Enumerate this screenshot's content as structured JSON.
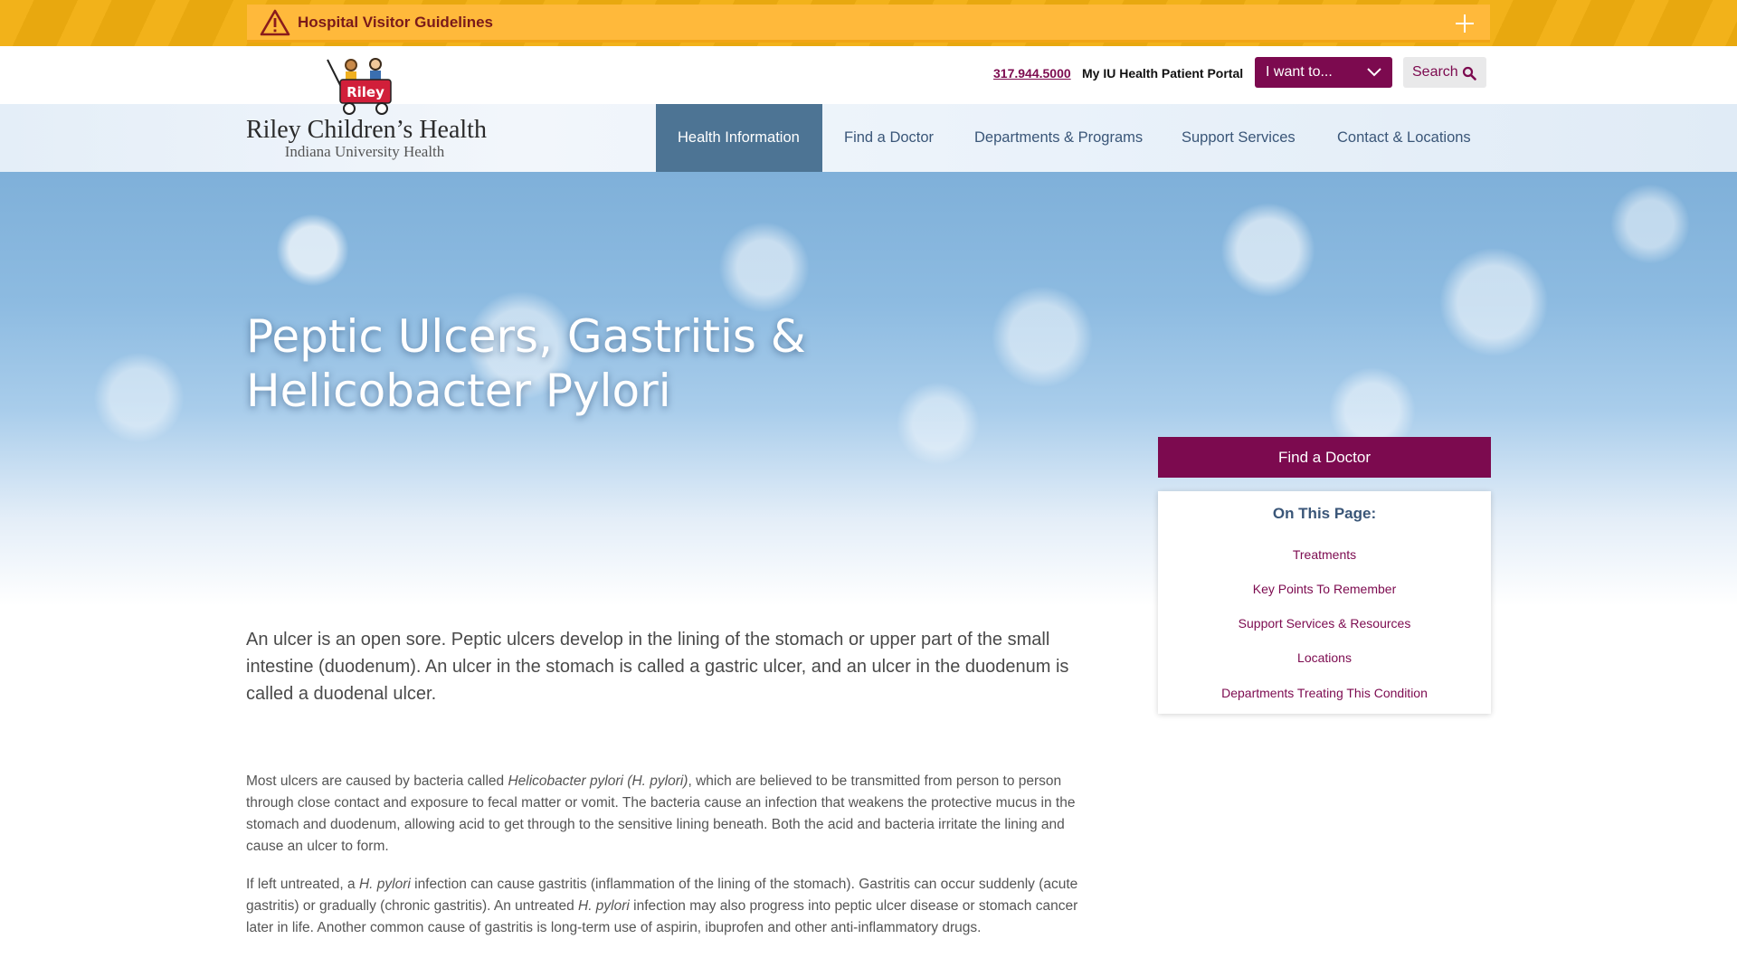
{
  "alert": {
    "title": "Hospital Visitor Guidelines",
    "icon": "warning-triangle-icon",
    "toggle_icon": "plus-icon"
  },
  "utility": {
    "phone": "317.944.5000",
    "portal": "My IU Health Patient Portal",
    "i_want": "I want to...",
    "search": "Search"
  },
  "logo": {
    "badge_text": "Riley",
    "title": "Riley Children’s Health",
    "subtitle": "Indiana University Health"
  },
  "nav": {
    "items": [
      {
        "label": "Health Information",
        "active": true
      },
      {
        "label": "Find a Doctor",
        "active": false
      },
      {
        "label": "Departments & Programs",
        "active": false
      },
      {
        "label": "Support Services",
        "active": false
      },
      {
        "label": "Contact & Locations",
        "active": false
      }
    ]
  },
  "hero": {
    "title": "Peptic Ulcers, Gastritis & Helicobacter Pylori"
  },
  "sidebar": {
    "find_doctor": "Find a Doctor",
    "on_this_page": "On This Page:",
    "links": [
      "Treatments",
      "Key Points To Remember",
      "Support Services & Resources",
      "Locations",
      "Departments Treating This Condition"
    ]
  },
  "content": {
    "intro": "An ulcer is an open sore. Peptic ulcers develop in the lining of the stomach or upper part of the small intestine (duodenum). An ulcer in the stomach is called a gastric ulcer, and an ulcer in the duodenum is called a duodenal ulcer.",
    "p1_a": "Most ulcers are caused by bacteria called ",
    "p1_em": "Helicobacter pylori (H. pylori)",
    "p1_b": ", which are believed to be transmitted from person to person through close contact and exposure to fecal matter or vomit. The bacteria cause an infection that weakens the protective mucus in the stomach and duodenum, allowing acid to get through to the sensitive lining beneath. Both the acid and bacteria irritate the lining and cause an ulcer to form.",
    "p2_a": "If left untreated, a ",
    "p2_em1": "H. pylori",
    "p2_b": " infection can cause gastritis (inflammation of the lining of the stomach). Gastritis can occur suddenly (acute gastritis) or gradually (chronic gastritis). An untreated ",
    "p2_em2": "H. pylori",
    "p2_c": " infection may also progress into peptic ulcer disease or stomach cancer later in life. Another common cause of gastritis is long-term use of aspirin, ibuprofen and other anti-inflammatory drugs."
  },
  "colors": {
    "brand": "#7c0a4f",
    "alert": "#ffb93b",
    "nav_active": "#4d7494",
    "nav_text": "#3a5678"
  }
}
